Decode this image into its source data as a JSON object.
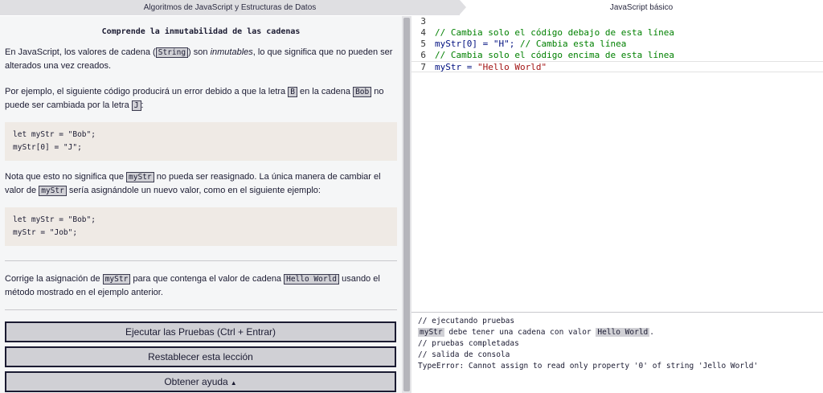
{
  "breadcrumb": {
    "first": "Algoritmos de JavaScript y Estructuras de Datos",
    "second": "JavaScript básico"
  },
  "lesson": {
    "title": "Comprende la inmutabilidad de las cadenas",
    "p1": {
      "a": "En JavaScript, los valores de cadena (",
      "code1": "String",
      "b": ") son ",
      "em": "inmutables",
      "c": ", lo que significa que no pueden ser alterados una vez creados."
    },
    "p2": {
      "a": "Por ejemplo, el siguiente código producirá un error debido a que la letra ",
      "code1": "B",
      "b": " en la cadena ",
      "code2": "Bob",
      "c": " no puede ser cambiada por la letra ",
      "code3": "J",
      "d": ":"
    },
    "example1": {
      "line1": "let myStr = \"Bob\";",
      "line2": "myStr[0] = \"J\";"
    },
    "p3": {
      "a": "Nota que esto no significa que ",
      "code1": "myStr",
      "b": " no pueda ser reasignado. La única manera de cambiar el valor de ",
      "code2": "myStr",
      "c": " sería asignándole un nuevo valor, como en el siguiente ejemplo:"
    },
    "example2": {
      "line1": "let myStr = \"Bob\";",
      "line2": "myStr = \"Job\";"
    },
    "p4": {
      "a": "Corrige la asignación de ",
      "code1": "myStr",
      "b": " para que contenga el valor de cadena ",
      "code2": "Hello World",
      "c": " usando el método mostrado en el ejemplo anterior."
    }
  },
  "buttons": {
    "run": "Ejecutar las Pruebas (Ctrl + Entrar)",
    "reset": "Restablecer esta lección",
    "help": "Obtener ayuda",
    "help_caret": "▲"
  },
  "editor": {
    "lines": [
      {
        "num": "3",
        "text": ""
      },
      {
        "num": "4",
        "text": "// Cambia solo el código debajo de esta línea"
      },
      {
        "num": "5",
        "code": "myStr[0] = \"H\";",
        "comment": " // Cambia esta línea"
      },
      {
        "num": "6",
        "text": "// Cambia solo el código encima de esta línea"
      },
      {
        "num": "7",
        "var": "myStr = ",
        "str": "\"Hello World\""
      }
    ]
  },
  "console": {
    "l1": "// ejecutando pruebas",
    "l2_code1": "myStr",
    "l2_text": " debe tener una cadena con valor ",
    "l2_code2": "Hello World",
    "l2_end": ".",
    "l3": "// pruebas completadas",
    "l4": "// salida de consola",
    "l5": "TypeError: Cannot assign to read only property '0' of string 'Jello World'"
  }
}
